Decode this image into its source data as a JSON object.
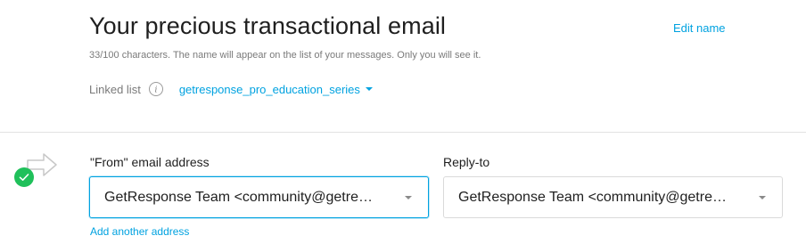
{
  "header": {
    "title": "Your precious transactional email",
    "edit_name_label": "Edit name",
    "helper_text": "33/100 characters. The name will appear on the list of your messages. Only you will see it."
  },
  "linked_list": {
    "label": "Linked list",
    "info_icon": "info-icon",
    "selected": "getresponse_pro_education_series"
  },
  "sender": {
    "status_icon": "check-circle-icon",
    "status_color": "#1fc05a",
    "from_label": "\"From\" email address",
    "from_value": "GetResponse Team <community@getre…",
    "reply_label": "Reply-to",
    "reply_value": "GetResponse Team <community@getre…",
    "add_address_label": "Add another address"
  },
  "colors": {
    "accent": "#00a2e0",
    "muted_text": "#7a7a7a",
    "success": "#1fc05a"
  }
}
